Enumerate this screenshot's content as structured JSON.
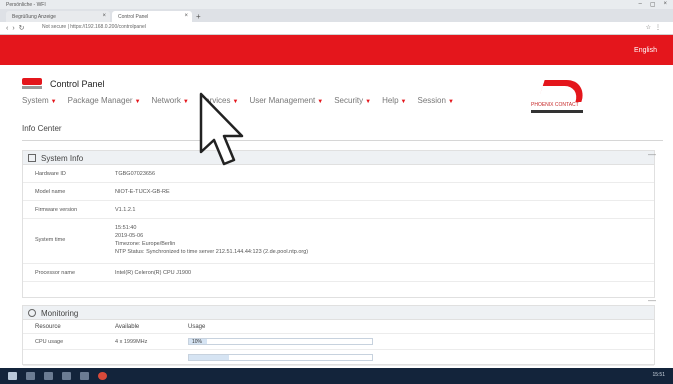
{
  "browser": {
    "window_label": "Persönliche - WFI",
    "tabs": [
      "Begrüßung Anzeige",
      "Control Panel"
    ],
    "address": "Not secure | https://192.168.0.200/controlpanel",
    "new_tab_symbol": "+"
  },
  "header": {
    "language": "English",
    "app_title": "Control Panel",
    "corp_logo_text": "PHOENIX CONTACT"
  },
  "menu": [
    {
      "label": "System"
    },
    {
      "label": "Package Manager"
    },
    {
      "label": "Network"
    },
    {
      "label": "Services"
    },
    {
      "label": "User Management"
    },
    {
      "label": "Security"
    },
    {
      "label": "Help"
    },
    {
      "label": "Session"
    }
  ],
  "page_title": "Info Center",
  "system_info": {
    "title": "System Info",
    "rows": {
      "hardware_id": {
        "label": "Hardware ID",
        "value": "TGBG07023656"
      },
      "model_name": {
        "label": "Model name",
        "value": "NIOT-E-TIJCX-GB-RE"
      },
      "firmware_version": {
        "label": "Firmware version",
        "value": "V1.1.2.1"
      },
      "system_time": {
        "label": "System time",
        "time": "15:51:40",
        "date": "2019-05-06",
        "timezone": "Timezone: Europe/Berlin",
        "ntp": "NTP Status: Synchronized to time server 212.51.144.44:123 (2.de.pool.ntp.org)"
      },
      "processor": {
        "label": "Processor name",
        "value": "Intel(R) Celeron(R) CPU J1900"
      }
    }
  },
  "monitoring": {
    "title": "Monitoring",
    "columns": [
      "Resource",
      "Available",
      "Usage"
    ],
    "rows": [
      {
        "resource": "CPU usage",
        "available": "4 x 1999MHz",
        "usage_label": "10%",
        "usage_fraction": 0.1
      },
      {
        "resource": "",
        "available": "",
        "usage_label": "",
        "usage_fraction": 0.22
      }
    ]
  },
  "taskbar": {
    "clock": "15:51"
  },
  "colors": {
    "brand_red": "#e4161c",
    "panel_header": "#eef1f4",
    "taskbar": "#13243b"
  }
}
